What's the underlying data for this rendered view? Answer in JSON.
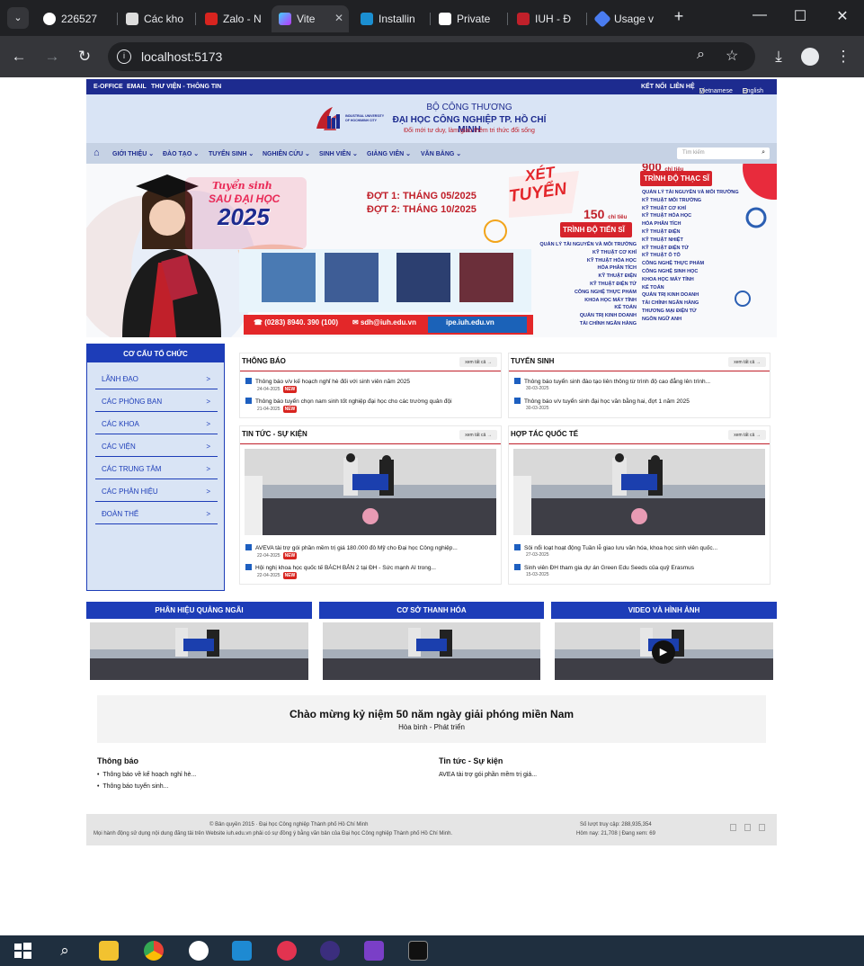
{
  "browser": {
    "tabs": [
      {
        "label": "226527"
      },
      {
        "label": "Các kho"
      },
      {
        "label": "Zalo - N"
      },
      {
        "label": "Vite"
      },
      {
        "label": "Installin"
      },
      {
        "label": "Private"
      },
      {
        "label": "IUH - Đ"
      },
      {
        "label": "Usage v"
      }
    ],
    "url": "localhost:5173"
  },
  "topbar": {
    "links": [
      "E-OFFICE",
      "EMAIL",
      "THƯ VIỆN - THÔNG TIN"
    ],
    "right": [
      "KẾT NỐI",
      "LIÊN HỆ",
      "Vietnamese",
      "English"
    ]
  },
  "header": {
    "line1": "BỘ CÔNG THƯƠNG",
    "line2": "ĐẠI HỌC CÔNG NGHIỆP TP. HỒ CHÍ MINH",
    "slogan": "Đổi mới tư duy, làm giàu thêm tri thức   đổi sống",
    "logo_text": "INDUSTRIAL UNIVERSITY OF HOCHIMINH CITY"
  },
  "nav": {
    "items": [
      "GIỚI THIỆU",
      "ĐÀO TẠO",
      "TUYỂN SINH",
      "NGHIÊN CỨU",
      "SINH VIÊN",
      "GIẢNG VIÊN",
      "VĂN BẰNG"
    ],
    "search_placeholder": "Tìm kiếm"
  },
  "banner": {
    "title1": "Tuyển sinh",
    "title2": "SAU ĐẠI HỌC",
    "year": "2025",
    "dot1": "ĐỢT 1: THÁNG 05/2025",
    "dot2": "ĐỢT 2: THÁNG 10/2025",
    "xet": "XÉT",
    "tuyen": "TUYỂN",
    "ts_count": "150",
    "ts_unit": "chỉ tiêu",
    "ts_label": "TRÌNH ĐỘ TIẾN SĨ",
    "ths_count": "900",
    "ths_unit": "chỉ tiêu",
    "ths_label": "TRÌNH ĐỘ THẠC SĨ",
    "phone": "(0283) 8940. 390 (100)",
    "email": "sdh@iuh.edu.vn",
    "web": "ipe.iuh.edu.vn",
    "ts_majors": [
      "QUẢN LÝ TÀI NGUYÊN VÀ MÔI TRƯỜNG",
      "KỸ THUẬT CƠ KHÍ",
      "KỸ THUẬT HÓA HỌC",
      "HÓA PHÂN TÍCH",
      "KỸ THUẬT ĐIỆN",
      "KỸ THUẬT ĐIỆN TỬ",
      "CÔNG NGHỆ THỰC PHẨM",
      "KHOA HỌC MÁY TÍNH",
      "KẾ TOÁN",
      "QUẢN TRỊ KINH DOANH",
      "TÀI CHÍNH NGÂN HÀNG"
    ],
    "ths_majors": [
      "QUẢN LÝ TÀI NGUYÊN VÀ MÔI TRƯỜNG",
      "KỸ THUẬT MÔI TRƯỜNG",
      "KỸ THUẬT CƠ KHÍ",
      "KỸ THUẬT HÓA HỌC",
      "HÓA PHÂN TÍCH",
      "KỸ THUẬT ĐIỆN",
      "KỸ THUẬT NHIỆT",
      "KỸ THUẬT ĐIỆN TỬ",
      "KỸ THUẬT Ô TÔ",
      "CÔNG NGHỆ THỰC PHẨM",
      "CÔNG NGHỆ SINH HỌC",
      "KHOA HỌC MÁY TÍNH",
      "KẾ TOÁN",
      "QUẢN TRỊ KINH DOANH",
      "TÀI CHÍNH NGÂN HÀNG",
      "THƯƠNG MẠI ĐIỆN TỬ",
      "NGÔN NGỮ ANH"
    ]
  },
  "sidebar": {
    "title": "CƠ CẤU TỔ CHỨC",
    "items": [
      "LÃNH ĐẠO",
      "CÁC PHÒNG BAN",
      "CÁC KHOA",
      "CÁC VIỆN",
      "CÁC TRUNG TÂM",
      "CÁC PHÂN HIỆU",
      "ĐOÀN THỂ"
    ],
    "arrow": ">"
  },
  "more_label": "xem tất cả →",
  "new_label": "NEW",
  "thongbao": {
    "title": "THÔNG BÁO",
    "items": [
      {
        "text": "Thông báo v/v kế hoạch nghỉ hè đối với sinh viên năm 2025",
        "date": "24-04-2025"
      },
      {
        "text": "Thông báo tuyển chọn nam sinh tốt nghiệp đại học cho các trường quân đội",
        "date": "21-04-2025"
      }
    ]
  },
  "tuyensinh": {
    "title": "TUYỂN SINH",
    "items": [
      {
        "text": "Thông báo tuyển sinh đào tạo liên thông từ trình độ cao đẳng lên trình...",
        "date": "30-03-2025"
      },
      {
        "text": "Thông báo v/v tuyển sinh đại học văn bằng hai, đợt 1 năm 2025",
        "date": "30-03-2025"
      }
    ]
  },
  "tintuc": {
    "title": "TIN TỨC - SỰ KIỆN",
    "items": [
      {
        "text": "AVEVA tài trợ gói phần mềm trị giá 180.000 đô Mỹ cho Đại học Công nghiệp...",
        "date": "22-04-2025"
      },
      {
        "text": "Hội nghị khoa học quốc tế BÁCH BẢN 2 tại ĐH - Sức mạnh AI trong...",
        "date": "22-04-2025"
      }
    ]
  },
  "hoptac": {
    "title": "HỢP TÁC QUỐC TẾ",
    "items": [
      {
        "text": "Sôi nổi loạt hoạt động Tuần lễ giao lưu văn hóa, khoa học sinh viên quốc...",
        "date": "27-03-2025"
      },
      {
        "text": "Sinh viên ĐH tham gia dự án Green Edu Seeds của quỹ Erasmus",
        "date": "15-03-2025"
      }
    ]
  },
  "video_sections": [
    "PHÂN HIỆU QUẢNG NGÃI",
    "CƠ SỞ THANH HÓA",
    "VIDEO VÀ HÌNH ẢNH"
  ],
  "welcome": {
    "title": "Chào mừng kỷ niệm 50 năm ngày giải phóng miền Nam",
    "subtitle": "Hòa bình - Phát triển"
  },
  "footer_cols": {
    "left_title": "Thông báo",
    "left_items": [
      "Thông báo về kế hoạch nghỉ hè...",
      "Thông báo tuyển sinh..."
    ],
    "right_title": "Tin tức - Sự kiện",
    "right_items": [
      "AVEA tài trợ gói phần mềm trị giá..."
    ]
  },
  "footer": {
    "copyright": "© Bản quyền 2015 · Đại học Công nghiệp Thành phố Hồ Chí Minh",
    "notice": "Mọi hành động sử dụng nội dung đăng tải trên Website iuh.edu.vn phải có sự đồng ý bằng văn bản của Đại học Công nghiệp Thành phố Hồ Chí Minh.",
    "visits": "Số lượt truy cập: 288,935,354",
    "today": "Hôm nay: 21,708 | Đang xem: 69"
  },
  "colors": {
    "brand_blue": "#1d3db8",
    "navy": "#1d2b8f",
    "red": "#c0202a"
  }
}
